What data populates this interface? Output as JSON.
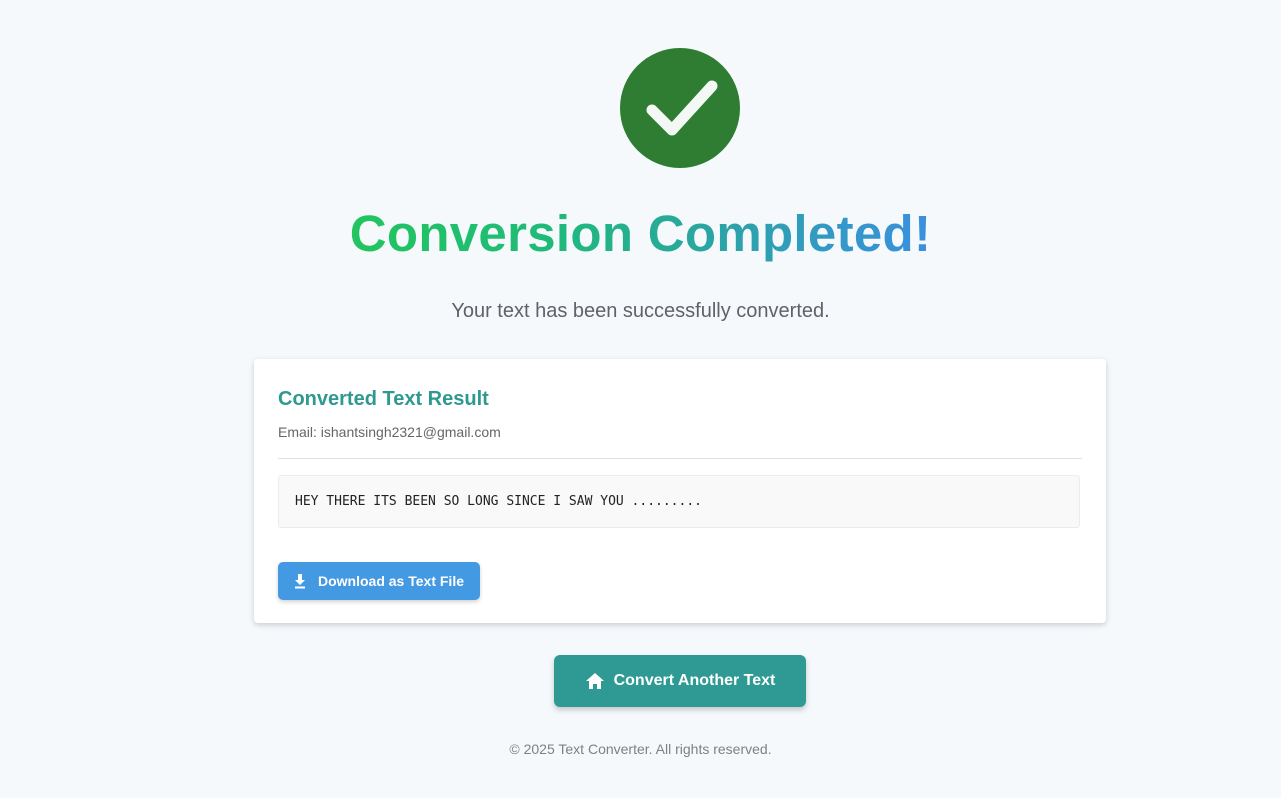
{
  "header": {
    "headline": "Conversion Completed!",
    "subtitle": "Your text has been successfully converted.",
    "icon": "check-circle-icon",
    "icon_color": "#2e7d32",
    "headline_gradient": [
      "#22c55e",
      "#3a8fe0"
    ]
  },
  "result_card": {
    "title": "Converted Text Result",
    "email": "Email: ishantsingh2321@gmail.com",
    "converted_text": "HEY THERE ITS BEEN SO LONG SINCE I SAW YOU .........",
    "download_label": "Download as Text File",
    "download_icon": "download-icon",
    "title_color": "#2e9990",
    "download_color": "#4499e3"
  },
  "actions": {
    "convert_another_label": "Convert Another Text",
    "convert_another_icon": "home-icon",
    "button_color": "#2f9a94"
  },
  "footer": {
    "copyright": "© 2025 Text Converter. All rights reserved."
  }
}
